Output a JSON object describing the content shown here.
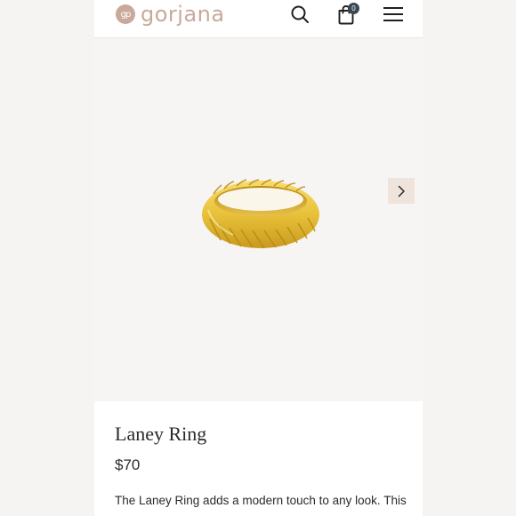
{
  "header": {
    "logo_mark": "gp",
    "logo_text": "gorjana",
    "cart_count": "0",
    "icons": {
      "search": "search-icon",
      "bag": "shopping-bag-icon",
      "menu": "hamburger-menu-icon"
    }
  },
  "hero": {
    "image": "gold-ring-image",
    "next_icon": "chevron-right-icon"
  },
  "product": {
    "name": "Laney Ring",
    "price": "$70",
    "description": "The Laney Ring adds a modern touch to any look. This"
  },
  "colors": {
    "brand": "#c9a99a",
    "badge": "#3a4750",
    "gold": "#e8c13a",
    "next_button_bg": "#efe4dc"
  }
}
